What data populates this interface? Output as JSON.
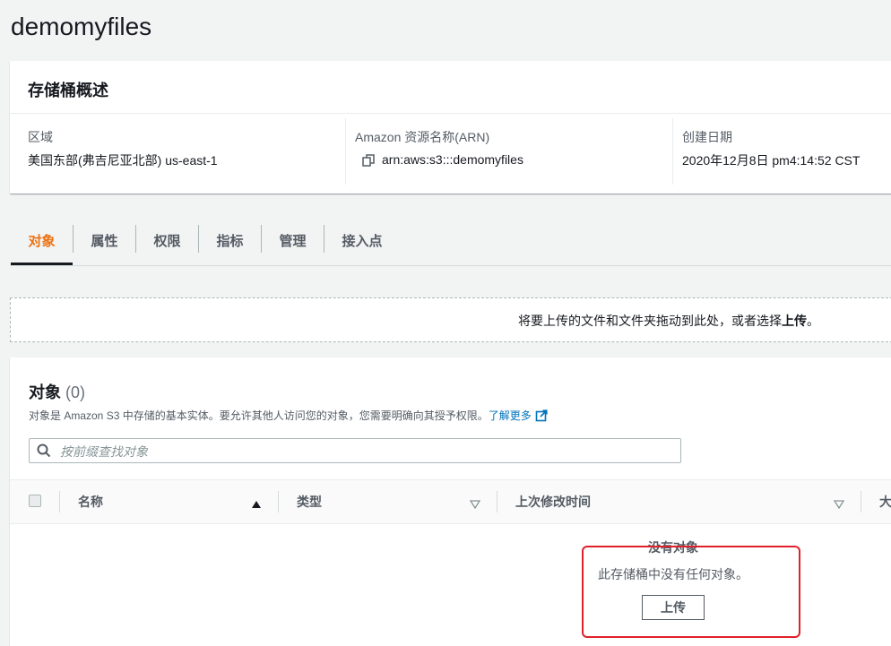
{
  "page": {
    "title": "demomyfiles"
  },
  "overview": {
    "title": "存储桶概述",
    "region_label": "区域",
    "region_value": "美国东部(弗吉尼亚北部) us-east-1",
    "arn_label": "Amazon 资源名称(ARN)",
    "arn_value": "arn:aws:s3:::demomyfiles",
    "created_label": "创建日期",
    "created_value": "2020年12月8日 pm4:14:52 CST"
  },
  "tabs": [
    {
      "label": "对象",
      "active": true
    },
    {
      "label": "属性",
      "active": false
    },
    {
      "label": "权限",
      "active": false
    },
    {
      "label": "指标",
      "active": false
    },
    {
      "label": "管理",
      "active": false
    },
    {
      "label": "接入点",
      "active": false
    }
  ],
  "dropzone": {
    "text": "将要上传的文件和文件夹拖动到此处，或者选择",
    "link_text": "上传",
    "suffix": "。"
  },
  "objects": {
    "title": "对象",
    "count": "(0)",
    "description": "对象是 Amazon S3 中存储的基本实体。要允许其他人访问您的对象，您需要明确向其授予权限。",
    "learn_more": "了解更多",
    "search_placeholder": "按前缀查找对象",
    "columns": {
      "name": "名称",
      "type": "类型",
      "last_modified": "上次修改时间",
      "size": "大"
    },
    "empty_title": "没有对象",
    "empty_description": "此存储桶中没有任何对象。",
    "upload_button": "上传"
  },
  "icons": {
    "copy": "copy-icon",
    "external_link": "external-link-icon",
    "search": "search-icon",
    "sort_asc": "sort-ascending-icon",
    "sort": "sort-icon"
  },
  "colors": {
    "accent_orange": "#ec7211",
    "link_blue": "#0073bb",
    "highlight_red": "#e0202a"
  }
}
